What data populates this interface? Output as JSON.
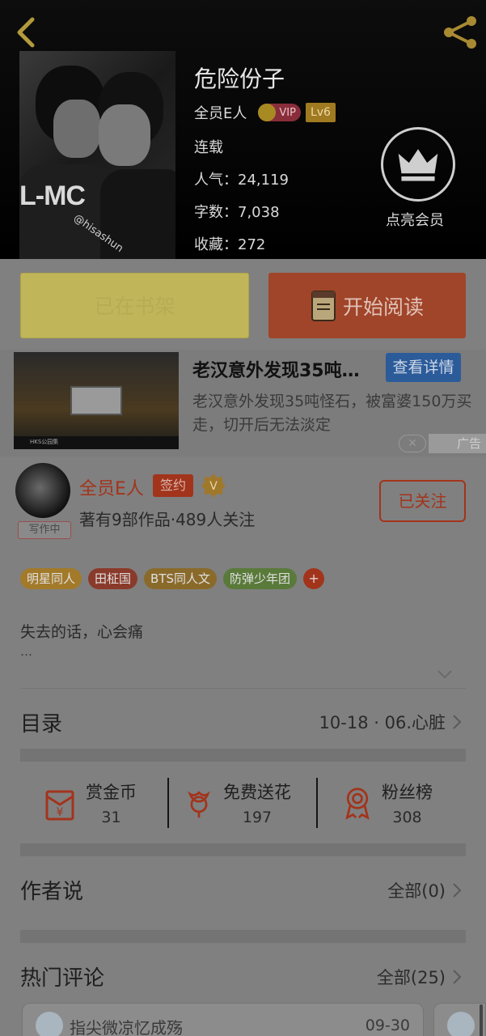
{
  "book": {
    "title": "危险份子",
    "author": "全员E人",
    "vip_label": "VIP",
    "level": "Lv6",
    "status": "连载",
    "popularity": "人气：24,119",
    "word_count": "字数：7,038",
    "favorites": "收藏：272",
    "cover_text": "L-MC",
    "cover_handle": "@hisashun",
    "member_label": "点亮会员"
  },
  "actions": {
    "shelf_label": "已在书架",
    "read_label": "开始阅读"
  },
  "ad": {
    "title": "老汉意外发现35吨…",
    "detail_button": "查看详情",
    "description": "老汉意外发现35吨怪石，被富婆150万买走，切开后无法淡定",
    "close": "✕",
    "tag": "广告",
    "thumb_caption": "HKS公园集"
  },
  "writer": {
    "name": "全员E人",
    "sign_badge": "签约",
    "writing_badge": "写作中",
    "stats": "著有9部作品·489人关注",
    "follow_label": "已关注"
  },
  "tags": [
    {
      "label": "明星同人",
      "color": "#a27a2a"
    },
    {
      "label": "田柾国",
      "color": "#8a3a2a"
    },
    {
      "label": "BTS同人文",
      "color": "#8a6a2a"
    },
    {
      "label": "防弹少年团",
      "color": "#5a7a3a"
    }
  ],
  "tag_plus": "+",
  "intro": {
    "line1": "失去的话，心会痛",
    "line2": "…"
  },
  "catalog": {
    "title": "目录",
    "latest": "10-18 · 06.心脏"
  },
  "stats": [
    {
      "label": "赏金币",
      "value": "31",
      "icon": "red-envelope-icon"
    },
    {
      "label": "免费送花",
      "value": "197",
      "icon": "flower-icon"
    },
    {
      "label": "粉丝榜",
      "value": "308",
      "icon": "medal-icon"
    }
  ],
  "author_says": {
    "title": "作者说",
    "all_label": "全部(0)"
  },
  "hot_comments": {
    "title": "热门评论",
    "all_label": "全部(25)",
    "items": [
      {
        "name": "指尖微凉忆成殇",
        "date": "09-30"
      }
    ]
  },
  "colors": {
    "accent_red": "#a2341c",
    "read_button": "#a0452a",
    "shelf_button": "#c1b55a",
    "detail_blue": "#2c5b9a"
  }
}
